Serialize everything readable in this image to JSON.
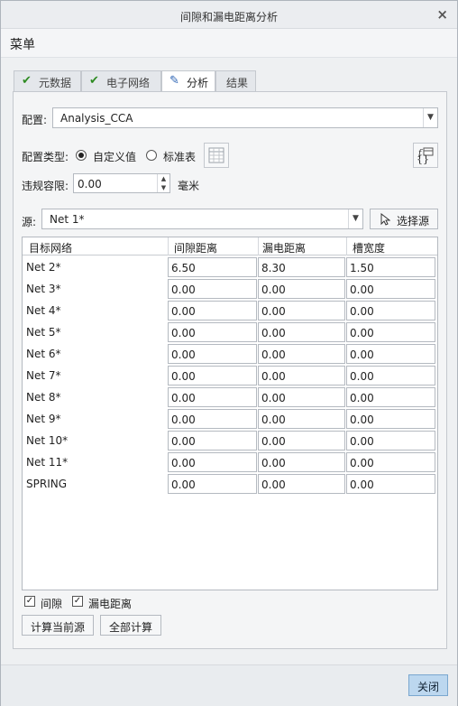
{
  "window": {
    "title": "间隙和漏电距离分析",
    "close_glyph": "×"
  },
  "menu": {
    "label": "菜单"
  },
  "tabs": [
    {
      "label": "元数据",
      "icon": "check-icon"
    },
    {
      "label": "电子网络",
      "icon": "check-icon"
    },
    {
      "label": "分析",
      "icon": "pencil-icon"
    },
    {
      "label": "结果",
      "icon": ""
    }
  ],
  "config": {
    "label": "配置:",
    "value": "Analysis_CCA"
  },
  "config_type": {
    "label": "配置类型:",
    "option_custom": "自定义值",
    "option_table": "标准表",
    "selected": "custom"
  },
  "tolerance": {
    "label": "违规容限:",
    "value": "0.00",
    "unit": "毫米"
  },
  "source": {
    "label": "源:",
    "value": "Net 1*",
    "select_button": "选择源"
  },
  "table": {
    "headers": [
      "目标网络",
      "间隙距离",
      "漏电距离",
      "槽宽度"
    ],
    "rows": [
      {
        "net": "Net 2*",
        "clearance": "6.50",
        "creepage": "8.30",
        "slot": "1.50"
      },
      {
        "net": "Net 3*",
        "clearance": "0.00",
        "creepage": "0.00",
        "slot": "0.00"
      },
      {
        "net": "Net 4*",
        "clearance": "0.00",
        "creepage": "0.00",
        "slot": "0.00"
      },
      {
        "net": "Net 5*",
        "clearance": "0.00",
        "creepage": "0.00",
        "slot": "0.00"
      },
      {
        "net": "Net 6*",
        "clearance": "0.00",
        "creepage": "0.00",
        "slot": "0.00"
      },
      {
        "net": "Net 7*",
        "clearance": "0.00",
        "creepage": "0.00",
        "slot": "0.00"
      },
      {
        "net": "Net 8*",
        "clearance": "0.00",
        "creepage": "0.00",
        "slot": "0.00"
      },
      {
        "net": "Net 9*",
        "clearance": "0.00",
        "creepage": "0.00",
        "slot": "0.00"
      },
      {
        "net": "Net 10*",
        "clearance": "0.00",
        "creepage": "0.00",
        "slot": "0.00"
      },
      {
        "net": "Net 11*",
        "clearance": "0.00",
        "creepage": "0.00",
        "slot": "0.00"
      },
      {
        "net": "SPRING",
        "clearance": "0.00",
        "creepage": "0.00",
        "slot": "0.00"
      }
    ]
  },
  "checks": {
    "clearance_label": "间隙",
    "clearance_checked": true,
    "creepage_label": "漏电距离",
    "creepage_checked": true,
    "mark": "✓"
  },
  "actions": {
    "compute_current": "计算当前源",
    "compute_all": "全部计算"
  },
  "footer": {
    "close_button": "关闭"
  },
  "colors": {
    "accent": "#bcd7ef",
    "check_green": "#2e8b22",
    "pencil_blue": "#2f66b5"
  }
}
